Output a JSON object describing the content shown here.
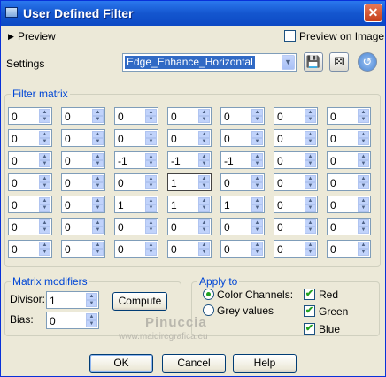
{
  "window": {
    "title": "User Defined Filter",
    "close_glyph": "✕"
  },
  "preview": {
    "label": "Preview",
    "arrow_icon": "triangle-right",
    "on_image_label": "Preview on Image",
    "on_image_checked": false
  },
  "settings": {
    "label": "Settings",
    "selected": "Edge_Enhance_Horizontal",
    "tools": [
      {
        "name": "save-preset-icon",
        "glyph": "💾"
      },
      {
        "name": "randomize-dice-icon",
        "glyph": "⚄"
      },
      {
        "name": "reset-icon",
        "glyph": "↺"
      }
    ]
  },
  "filter_matrix": {
    "legend": "Filter matrix",
    "rows": [
      [
        "0",
        "0",
        "0",
        "0",
        "0",
        "0",
        "0"
      ],
      [
        "0",
        "0",
        "0",
        "0",
        "0",
        "0",
        "0"
      ],
      [
        "0",
        "0",
        "-1",
        "-1",
        "-1",
        "0",
        "0"
      ],
      [
        "0",
        "0",
        "0",
        "1",
        "0",
        "0",
        "0"
      ],
      [
        "0",
        "0",
        "1",
        "1",
        "1",
        "0",
        "0"
      ],
      [
        "0",
        "0",
        "0",
        "0",
        "0",
        "0",
        "0"
      ],
      [
        "0",
        "0",
        "0",
        "0",
        "0",
        "0",
        "0"
      ]
    ]
  },
  "modifiers": {
    "legend": "Matrix modifiers",
    "divisor_label": "Divisor:",
    "divisor": "1",
    "bias_label": "Bias:",
    "bias": "0",
    "compute_label": "Compute"
  },
  "apply_to": {
    "legend": "Apply to",
    "color_channels": "Color Channels:",
    "grey_values": "Grey values",
    "selected_mode": "color_channels",
    "channels": [
      {
        "label": "Red",
        "checked": true
      },
      {
        "label": "Green",
        "checked": true
      },
      {
        "label": "Blue",
        "checked": true
      }
    ]
  },
  "watermark": {
    "title": "Pinuccia",
    "url": "www.maidiregrafica.eu"
  },
  "buttons": {
    "ok": "OK",
    "cancel": "Cancel",
    "help": "Help"
  }
}
